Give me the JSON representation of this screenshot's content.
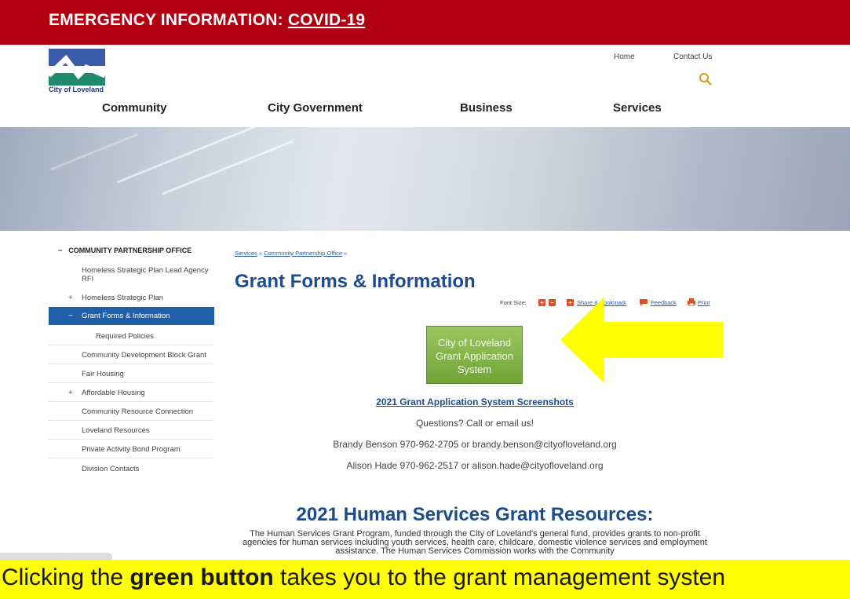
{
  "emergency": {
    "prefix": "EMERGENCY INFORMATION:",
    "link": "COVID-19"
  },
  "logo": {
    "text": "City of Loveland"
  },
  "utility_nav": {
    "home": "Home",
    "contact": "Contact Us"
  },
  "main_nav": [
    "Community",
    "City Government",
    "Business",
    "Services"
  ],
  "sidebar": {
    "heading": "COMMUNITY PARTNERSHIP OFFICE",
    "items": [
      {
        "bullet": "",
        "label": "Homeless Strategic Plan Lead Agency RFI"
      },
      {
        "bullet": "+",
        "label": "Homeless Strategic Plan"
      },
      {
        "bullet": "−",
        "label": "Grant Forms & Information",
        "active": true
      },
      {
        "bullet": "",
        "label": "Required Policies",
        "sub": true
      },
      {
        "bullet": "",
        "label": "Community Development Block Grant"
      },
      {
        "bullet": "",
        "label": "Fair Housing"
      },
      {
        "bullet": "+",
        "label": "Affordable Housing"
      },
      {
        "bullet": "",
        "label": "Community Resource Connection"
      },
      {
        "bullet": "",
        "label": "Loveland Resources"
      },
      {
        "bullet": "",
        "label": "Private Activity Bond Program"
      },
      {
        "bullet": "",
        "label": "Division Contacts"
      }
    ]
  },
  "breadcrumb": [
    "Services",
    "Community Partnership Office"
  ],
  "page_title": "Grant Forms & Information",
  "tools": {
    "font_size_label": "Font Size:",
    "share_label": "Share & Bookmark",
    "feedback_label": "Feedback",
    "print_label": "Print"
  },
  "grant_button": {
    "label": "City of Loveland Grant Application System",
    "color": "#7fb245"
  },
  "screenshots_link": "2021 Grant Application System Screenshots",
  "contact": {
    "question": "Questions? Call or email us!",
    "line1": "Brandy Benson 970-962-2705 or brandy.benson@cityofloveland.org",
    "line2": "Alison Hade 970-962-2517 or alison.hade@cityofloveland.org"
  },
  "resources": {
    "title": "2021 Human Services Grant Resources:",
    "para": "The Human Services Grant Program, funded through the City of Loveland's general fund, provides grants to non-profit agencies for human services including youth services, health care, childcare, domestic violence services and employment assistance. The Human Services Commission works with the Community"
  },
  "caption": {
    "before": "Clicking the ",
    "bold": "green button",
    "after": " takes you to the grant management systen"
  },
  "colors": {
    "brand_red": "#b00012",
    "brand_blue": "#1c4c8c",
    "annotation_yellow": "#ffff00"
  }
}
